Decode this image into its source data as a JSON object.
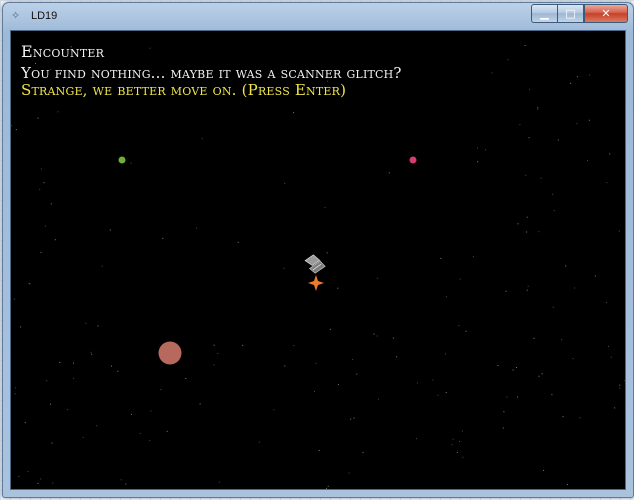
{
  "window": {
    "title": "LD19",
    "minimize_glyph": "▁",
    "maximize_glyph": "□",
    "close_glyph": "✕"
  },
  "dialog": {
    "heading": "Encounter",
    "message": "You find nothing... maybe it was a scanner glitch?",
    "prompt": "Strange, we better move on. (Press Enter)"
  },
  "colors": {
    "heading_text": "#f2f2f2",
    "prompt_text": "#f0e64a",
    "space_background": "#000000",
    "planet_green": "#6fae3c",
    "planet_pink": "#d83a74",
    "planet_brown": "#b8695d",
    "ship_thruster": "#f07a2a",
    "ship_hull": "#8a8a8a"
  },
  "icons": {
    "app": "game-window-icon",
    "ship": "player-ship-icon"
  }
}
